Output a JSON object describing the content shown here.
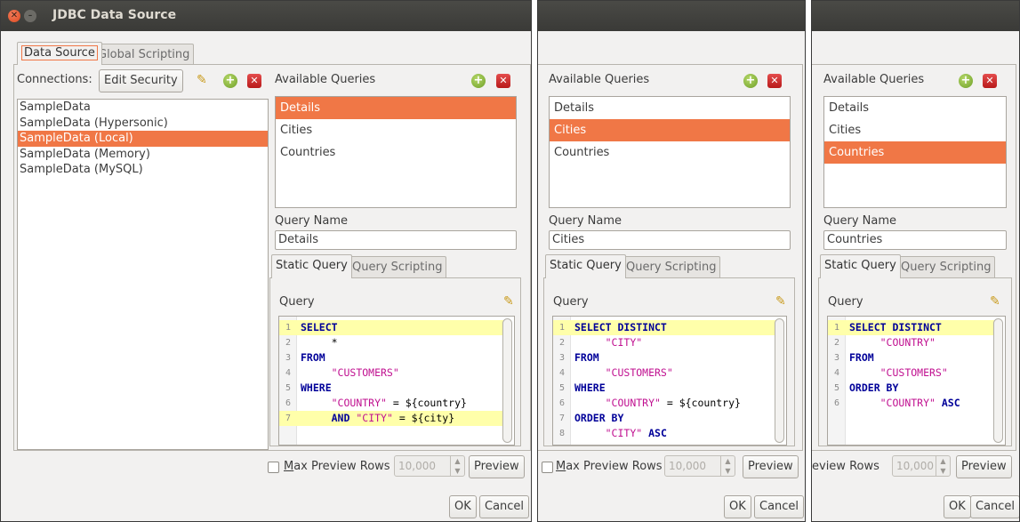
{
  "window": {
    "title": "JDBC Data Source",
    "close_glyph": "×",
    "minimize_glyph": "–"
  },
  "tabs": {
    "data_source": "Data Source",
    "global_scripting": "Global Scripting"
  },
  "connections": {
    "label": "Connections:",
    "edit_security": "Edit Security",
    "items": [
      "SampleData",
      "SampleData (Hypersonic)",
      "SampleData (Local)",
      "SampleData (Memory)",
      "SampleData (MySQL)"
    ],
    "selected_index": 2
  },
  "icons": {
    "pencil": "✎",
    "plus": "+",
    "x": "✕",
    "spin_up": "▲",
    "spin_down": "▼"
  },
  "queries_label": "Available Queries",
  "query_items": [
    "Details",
    "Cities",
    "Countries"
  ],
  "query_name_label": "Query Name",
  "subtabs": {
    "static_query": "Static Query",
    "query_scripting": "Query Scripting"
  },
  "query_label": "Query",
  "preview": {
    "max_rows_label_underlined": "M",
    "max_rows_label_rest": "ax Preview Rows",
    "max_rows_label_partial": "eview Rows",
    "max_rows_value": "10,000",
    "button": "Preview"
  },
  "buttons": {
    "ok": "OK",
    "cancel": "Cancel"
  },
  "panes": [
    {
      "selected_query": "Details",
      "query_name": "Details",
      "code": [
        [
          {
            "t": "SELECT",
            "c": "kw"
          }
        ],
        [
          {
            "t": "     *",
            "c": ""
          }
        ],
        [
          {
            "t": "FROM",
            "c": "kw"
          }
        ],
        [
          {
            "t": "     ",
            "c": ""
          },
          {
            "t": "\"CUSTOMERS\"",
            "c": "str"
          }
        ],
        [
          {
            "t": "WHERE",
            "c": "kw"
          }
        ],
        [
          {
            "t": "     ",
            "c": ""
          },
          {
            "t": "\"COUNTRY\"",
            "c": "str"
          },
          {
            "t": " = ${country}",
            "c": ""
          }
        ],
        [
          {
            "t": "     ",
            "c": ""
          },
          {
            "t": "AND",
            "c": "kw"
          },
          {
            "t": " ",
            "c": ""
          },
          {
            "t": "\"CITY\"",
            "c": "str"
          },
          {
            "t": " = ${city}",
            "c": ""
          }
        ]
      ]
    },
    {
      "selected_query": "Cities",
      "query_name": "Cities",
      "code": [
        [
          {
            "t": "SELECT DISTINCT",
            "c": "kw"
          }
        ],
        [
          {
            "t": "     ",
            "c": ""
          },
          {
            "t": "\"CITY\"",
            "c": "str"
          }
        ],
        [
          {
            "t": "FROM",
            "c": "kw"
          }
        ],
        [
          {
            "t": "     ",
            "c": ""
          },
          {
            "t": "\"CUSTOMERS\"",
            "c": "str"
          }
        ],
        [
          {
            "t": "WHERE",
            "c": "kw"
          }
        ],
        [
          {
            "t": "     ",
            "c": ""
          },
          {
            "t": "\"COUNTRY\"",
            "c": "str"
          },
          {
            "t": " = ${country}",
            "c": ""
          }
        ],
        [
          {
            "t": "ORDER BY",
            "c": "kw"
          }
        ],
        [
          {
            "t": "     ",
            "c": ""
          },
          {
            "t": "\"CITY\"",
            "c": "str"
          },
          {
            "t": " ",
            "c": ""
          },
          {
            "t": "ASC",
            "c": "kw"
          }
        ]
      ]
    },
    {
      "selected_query": "Countries",
      "query_name": "Countries",
      "code": [
        [
          {
            "t": "SELECT DISTINCT",
            "c": "kw"
          }
        ],
        [
          {
            "t": "     ",
            "c": ""
          },
          {
            "t": "\"COUNTRY\"",
            "c": "str"
          }
        ],
        [
          {
            "t": "FROM",
            "c": "kw"
          }
        ],
        [
          {
            "t": "     ",
            "c": ""
          },
          {
            "t": "\"CUSTOMERS\"",
            "c": "str"
          }
        ],
        [
          {
            "t": "ORDER BY",
            "c": "kw"
          }
        ],
        [
          {
            "t": "     ",
            "c": ""
          },
          {
            "t": "\"COUNTRY\"",
            "c": "str"
          },
          {
            "t": " ",
            "c": ""
          },
          {
            "t": "ASC",
            "c": "kw"
          }
        ]
      ]
    }
  ]
}
